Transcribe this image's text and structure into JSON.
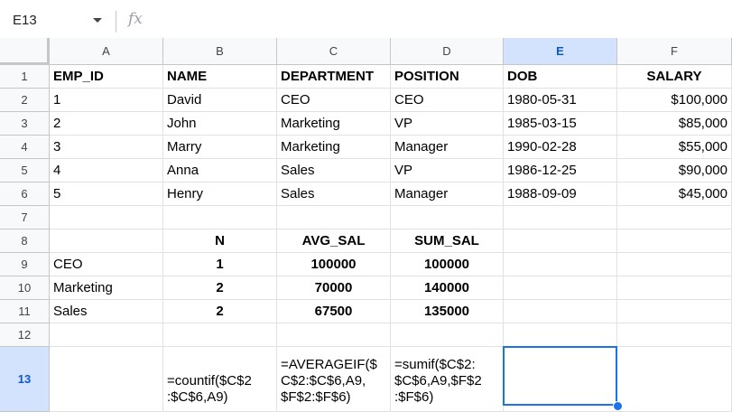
{
  "name_box": "E13",
  "formula_icon": "fx",
  "columns": [
    "A",
    "B",
    "C",
    "D",
    "E",
    "F"
  ],
  "rows": [
    "1",
    "2",
    "3",
    "4",
    "5",
    "6",
    "7",
    "8",
    "9",
    "10",
    "11",
    "12",
    "13"
  ],
  "cells": {
    "A1": "EMP_ID",
    "B1": "NAME",
    "C1": "DEPARTMENT",
    "D1": "POSITION",
    "E1": "DOB",
    "F1": "SALARY",
    "A2": "1",
    "B2": "David",
    "C2": "CEO",
    "D2": "CEO",
    "E2": "1980-05-31",
    "F2": "$100,000",
    "A3": "2",
    "B3": "John",
    "C3": "Marketing",
    "D3": "VP",
    "E3": "1985-03-15",
    "F3": "$85,000",
    "A4": "3",
    "B4": "Marry",
    "C4": "Marketing",
    "D4": "Manager",
    "E4": "1990-02-28",
    "F4": "$55,000",
    "A5": "4",
    "B5": "Anna",
    "C5": "Sales",
    "D5": "VP",
    "E5": "1986-12-25",
    "F5": "$90,000",
    "A6": "5",
    "B6": "Henry",
    "C6": "Sales",
    "D6": "Manager",
    "E6": "1988-09-09",
    "F6": "$45,000",
    "B8": "N",
    "C8": "AVG_SAL",
    "D8": "SUM_SAL",
    "A9": "CEO",
    "B9": "1",
    "C9": "100000",
    "D9": "100000",
    "A10": "Marketing",
    "B10": "2",
    "C10": "70000",
    "D10": "140000",
    "A11": "Sales",
    "B11": "2",
    "C11": "67500",
    "D11": "135000",
    "B13": "=countif($C$2\n:$C$6,A9)",
    "C13": "=AVERAGEIF($\nC$2:$C$6,A9,\n$F$2:$F$6)",
    "D13": "=sumif($C$2:\n$C$6,A9,$F$2\n:$F$6)"
  },
  "selected_cell": "E13",
  "colors": {
    "selection": "#1a73e8",
    "selected_header_bg": "#d3e3fd",
    "header_bg": "#f8f9fa"
  }
}
